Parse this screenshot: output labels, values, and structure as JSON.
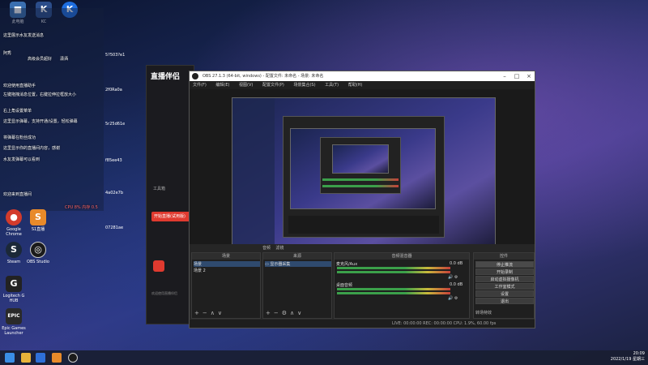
{
  "desktop": {
    "icons": [
      {
        "label": "Google Chrome",
        "icon": "chrome-icon",
        "color": "#d33b2c"
      },
      {
        "label": "Steam",
        "icon": "steam-icon",
        "color": "#1b2838"
      },
      {
        "label": "Logitech G HUB",
        "icon": "logitech-icon",
        "color": "#222"
      },
      {
        "label": "Epic Games Launcher",
        "icon": "epic-icon",
        "color": "#2a2a2a"
      },
      {
        "label": "S1直播",
        "icon": "s1-icon",
        "color": "#e88a2a"
      },
      {
        "label": "OBS Studio",
        "icon": "obs-icon",
        "color": "#1b1b1b"
      }
    ],
    "top_icons": [
      "此电脑",
      "KC",
      "K"
    ],
    "side_labels": [
      "5?503?e1",
      "2f0Ra0a",
      "5r25d61e",
      "f85ee43",
      "4a02e7b",
      "07281ae"
    ]
  },
  "chat": {
    "lines": [
      "这里展示水友发送消息",
      "阿秀",
      "高级会员超好",
      "潇洒",
      "欢迎使用直播助手",
      "左键拖拽消息位置，右键拉伸拉框放大小",
      "右上角设置菜单",
      "这里显示弹幕，支持开通/设置，轻松弹幕",
      "将弹幕在粉丝成功",
      "这里显示你的直播间内容，感谢",
      "水友发弹幕可以看到",
      "欢迎来到直播间"
    ],
    "stats": "CPU 8% 内存 0.5"
  },
  "helper_window": {
    "brand": "直播伴侣",
    "side_label": "工具箱",
    "go_live": "开始直播(试用版)",
    "bottom_hint": "欢迎使用直播伴侣"
  },
  "obs": {
    "title": "OBS 27.1.3 (64-bit, windows) - 配置文件: 未命名 - 场景: 未命名",
    "menu": [
      "文件(F)",
      "编辑(E)",
      "视图(V)",
      "配置文件(P)",
      "场景集合(S)",
      "工具(T)",
      "帮助(H)"
    ],
    "preview_tabs": [
      "音频",
      "滤镜"
    ],
    "dock_scene_title": "场景",
    "scenes": [
      "场景",
      "场景 2"
    ],
    "dock_source_title": "来源",
    "sources": [
      "显示器采集"
    ],
    "dock_mixer_title": "音频混音器",
    "mixer": [
      {
        "name": "麦克风/Aux",
        "level": "0.0 dB"
      },
      {
        "name": "桌面音频",
        "level": "0.0 dB"
      }
    ],
    "dock_controls_title": "控件",
    "controls": [
      "停止推流",
      "开始录制",
      "启动虚拟摄像机",
      "工作室模式",
      "设置",
      "退出"
    ],
    "dock_transition_title": "转场特效",
    "status": "LIVE: 00:00:00  REC: 00:00:00  CPU: 1.9%, 60.00 fps"
  },
  "taskbar": {
    "time": "20:09",
    "date": "2022/1/19 星期三"
  }
}
